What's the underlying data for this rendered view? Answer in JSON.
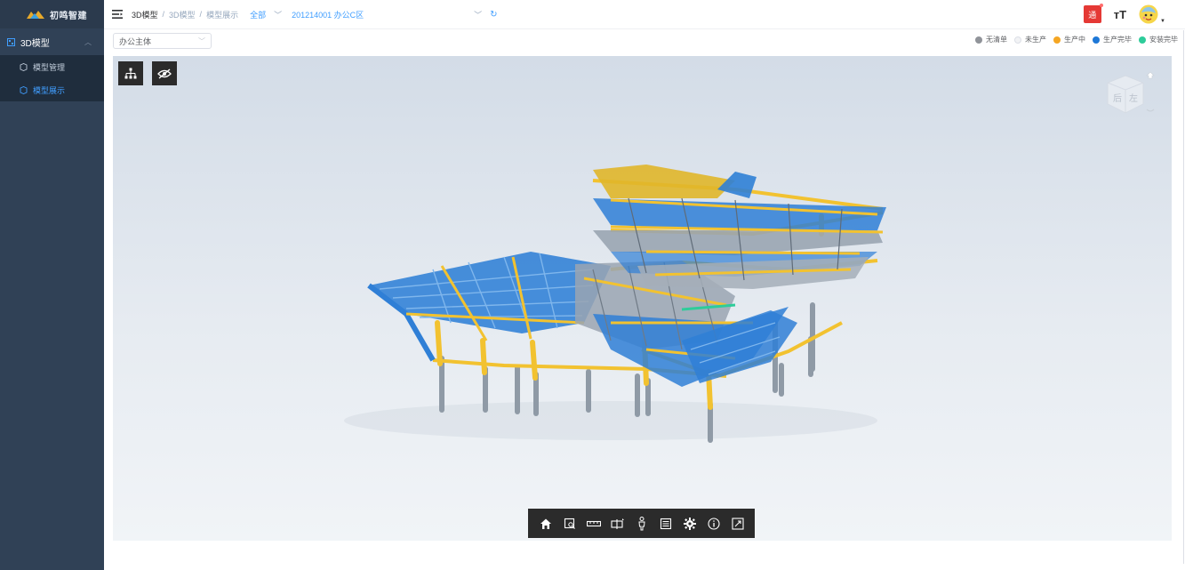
{
  "app": {
    "logo_text": "初鸣智建"
  },
  "sidebar": {
    "menu_title": "3D模型",
    "items": [
      {
        "label": "模型管理",
        "active": false
      },
      {
        "label": "模型展示",
        "active": true
      }
    ]
  },
  "breadcrumb": {
    "root": "3D模型",
    "sep1": "/",
    "mid": "3D模型",
    "sep2": "/",
    "current": "模型展示",
    "scope": "全部",
    "project": "201214001 办公C区"
  },
  "header": {
    "notice_badge": "通",
    "font_size_label": "тT"
  },
  "filter": {
    "body_select": "办公主体",
    "legend": [
      {
        "label": "无清单",
        "color": "#909399"
      },
      {
        "label": "未生产",
        "color": "#ebeef5"
      },
      {
        "label": "生产中",
        "color": "#f5a623"
      },
      {
        "label": "生产完毕",
        "color": "#1e78d7"
      },
      {
        "label": "安装完毕",
        "color": "#2ecc9a"
      }
    ]
  },
  "viewcube": {
    "top_label": "后",
    "front_label": "左"
  },
  "icons": {
    "viewport_left": [
      "structure-tree-icon",
      "hide-eye-icon"
    ],
    "toolbar": [
      "home-icon",
      "zoom-window-icon",
      "measure-icon",
      "section-icon",
      "walk-person-icon",
      "properties-icon",
      "settings-gear-icon",
      "info-icon",
      "fullscreen-icon"
    ]
  },
  "colors": {
    "accent": "#409eff",
    "sidebar_bg": "#304156",
    "steel_blue": "#2f7fd6",
    "steel_yellow": "#f2c230",
    "steel_grey": "#8f9aa6"
  }
}
